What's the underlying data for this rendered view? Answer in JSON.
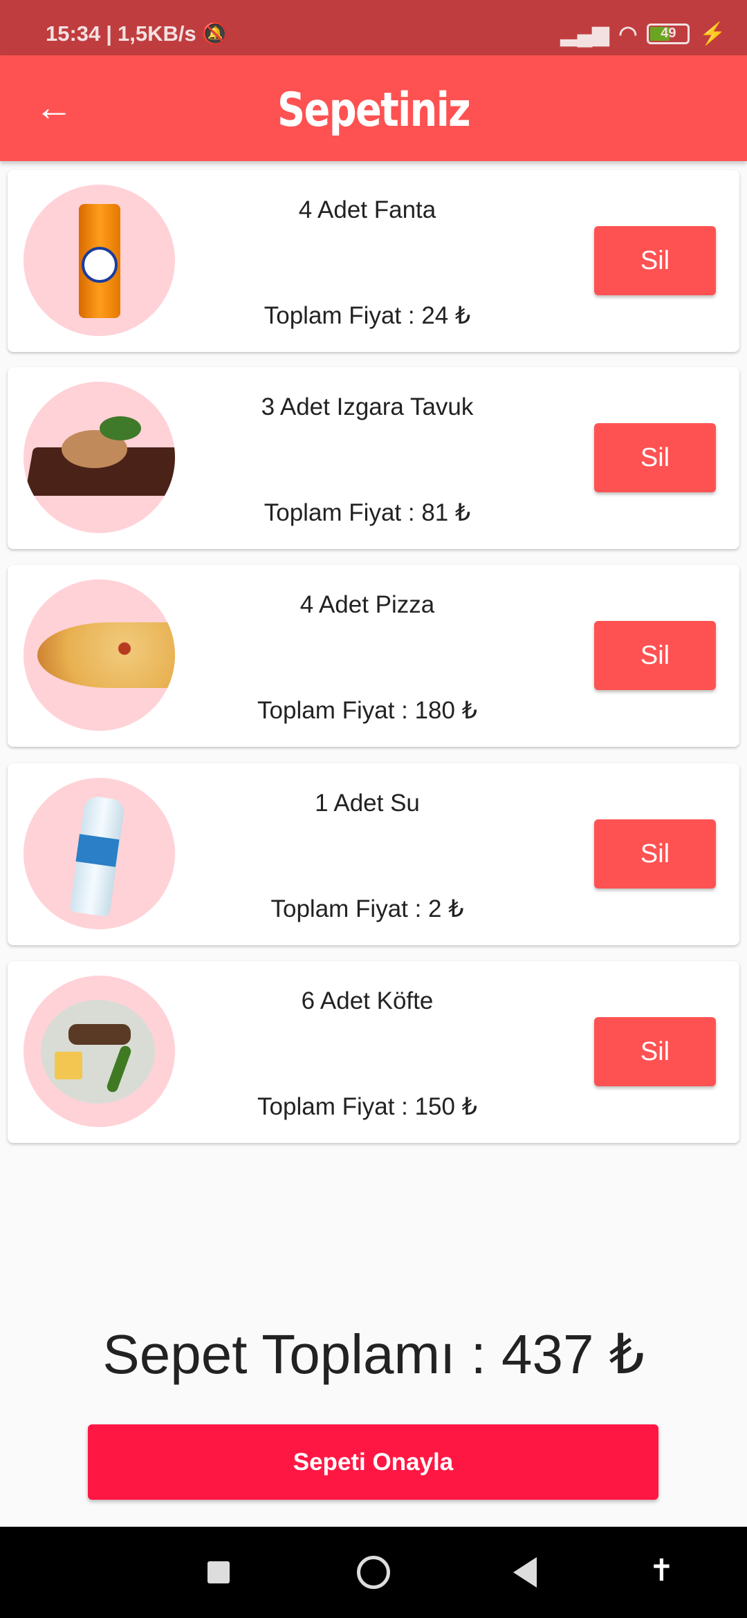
{
  "status": {
    "time": "15:34",
    "speed": "1,5KB/s",
    "battery": "49"
  },
  "header": {
    "title": "Sepetiniz"
  },
  "items": [
    {
      "name": "4 Adet Fanta",
      "price": "Toplam Fiyat : 24 ₺",
      "image": "fanta-can"
    },
    {
      "name": "3 Adet Izgara Tavuk",
      "price": "Toplam Fiyat : 81 ₺",
      "image": "grilled-chicken"
    },
    {
      "name": "4 Adet Pizza",
      "price": "Toplam Fiyat : 180 ₺",
      "image": "pizza"
    },
    {
      "name": "1 Adet Su",
      "price": "Toplam Fiyat : 2 ₺",
      "image": "water-bottle"
    },
    {
      "name": "6 Adet Köfte",
      "price": "Toplam Fiyat : 150 ₺",
      "image": "kofte-plate"
    }
  ],
  "delete_label": "Sil",
  "total": "Sepet Toplamı : 437 ₺",
  "confirm_label": "Sepeti Onayla",
  "colors": {
    "primary": "#fe5252",
    "confirm": "#ff1744",
    "status": "#c03d3f"
  }
}
